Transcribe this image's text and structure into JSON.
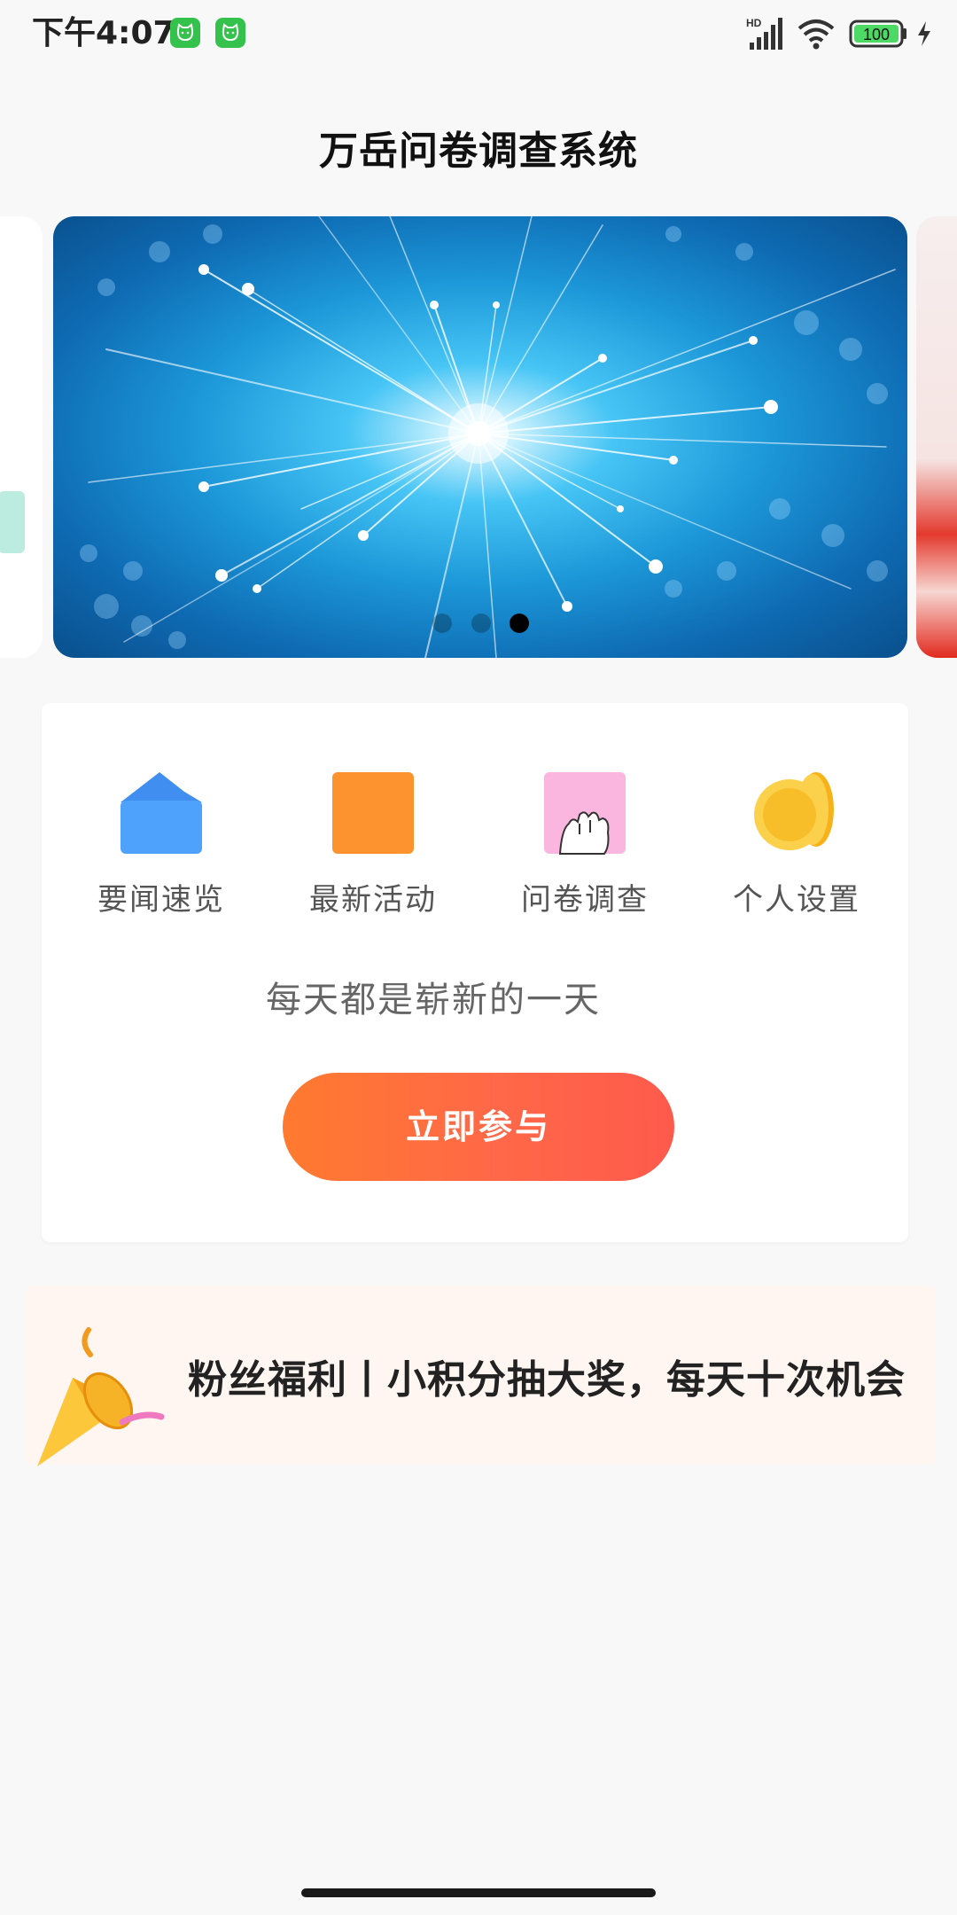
{
  "status_bar": {
    "time": "下午4:07",
    "battery_level": "100",
    "network_label": "HD",
    "app_badges": [
      "cat-app-icon",
      "cat-app-icon"
    ]
  },
  "header": {
    "title": "万岳问卷调查系统"
  },
  "carousel": {
    "active_index": 2,
    "slide_count": 3
  },
  "features": [
    {
      "label": "要闻速览",
      "icon": "folder-icon",
      "color": "#4a9cf6"
    },
    {
      "label": "最新活动",
      "icon": "square-icon",
      "color": "#fd932e"
    },
    {
      "label": "问卷调查",
      "icon": "hand-icon",
      "color": "#fbb6e0"
    },
    {
      "label": "个人设置",
      "icon": "coin-icon",
      "color": "#f9c234"
    }
  ],
  "tagline": "每天都是崭新的一天",
  "join_button": {
    "label": "立即参与",
    "gradient": [
      "#ff7a2f",
      "#fe5a4c"
    ]
  },
  "promo": {
    "text": "粉丝福利丨小积分抽大奖，每天十次机会",
    "icon": "party-horn-icon",
    "background": "#fff6f1"
  }
}
